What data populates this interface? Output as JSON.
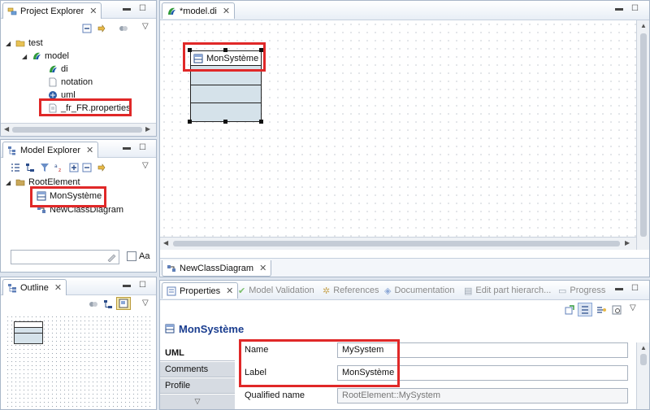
{
  "project_explorer": {
    "title": "Project Explorer",
    "items": [
      {
        "label": "test"
      },
      {
        "label": "model"
      },
      {
        "label": "di"
      },
      {
        "label": "notation"
      },
      {
        "label": "uml"
      },
      {
        "label": "_fr_FR.properties"
      }
    ]
  },
  "model_explorer": {
    "title": "Model Explorer",
    "items": [
      {
        "label": "RootElement"
      },
      {
        "label": "MonSystème"
      },
      {
        "label": "NewClassDiagram"
      }
    ],
    "filter_value": "",
    "case_label": "Aa"
  },
  "outline": {
    "title": "Outline"
  },
  "editor": {
    "tab_label": "*model.di",
    "class_name": "MonSystème",
    "diagram_tab_label": "NewClassDiagram"
  },
  "properties": {
    "tabs": [
      {
        "label": "Properties"
      },
      {
        "label": "Model Validation"
      },
      {
        "label": "References"
      },
      {
        "label": "Documentation"
      },
      {
        "label": "Edit part hierarch..."
      },
      {
        "label": "Progress"
      }
    ],
    "heading": "MonSystème",
    "side_tabs": [
      {
        "label": "UML"
      },
      {
        "label": "Comments"
      },
      {
        "label": "Profile"
      }
    ],
    "fields": {
      "name_label": "Name",
      "name_value": "MySystem",
      "label_label": "Label",
      "label_value": "MonSystème",
      "qualified_label": "Qualified name",
      "qualified_value": "RootElement::MySystem"
    }
  },
  "colors": {
    "highlight": "#e02828",
    "accent": "#1a3d8f"
  }
}
